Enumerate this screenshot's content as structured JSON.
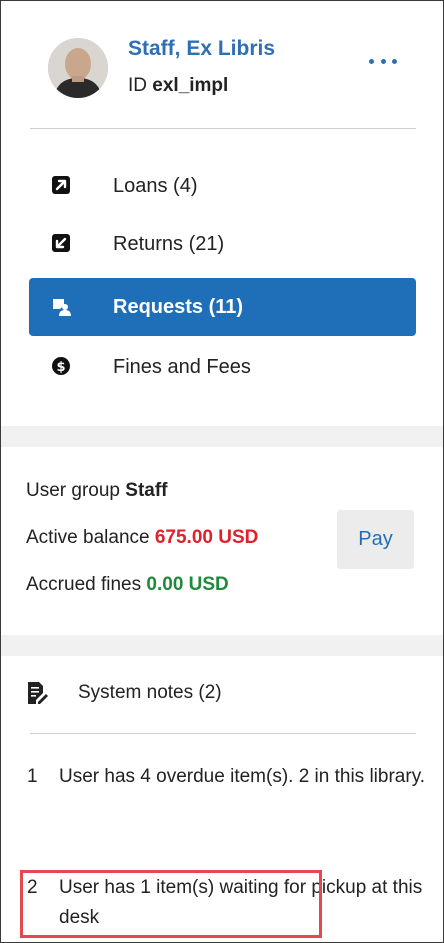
{
  "user": {
    "name": "Staff, Ex Libris",
    "id_label": "ID",
    "id_value": "exl_impl",
    "avatar_icon": "user-avatar-photo",
    "more_icon": "more-options-icon"
  },
  "nav": {
    "items": [
      {
        "label": "Loans (4)",
        "icon": "loan-out-icon"
      },
      {
        "label": "Returns (21)",
        "icon": "return-in-icon"
      },
      {
        "label": "Requests (11)",
        "icon": "requests-person-icon",
        "active": true
      },
      {
        "label": "Fines and Fees",
        "icon": "dollar-circle-icon"
      }
    ]
  },
  "account": {
    "user_group_label": "User group",
    "user_group_value": "Staff",
    "active_balance_label": "Active balance",
    "active_balance_value": "675.00 USD",
    "pay_label": "Pay",
    "accrued_fines_label": "Accrued fines",
    "accrued_fines_value": "0.00 USD"
  },
  "notes": {
    "title": "System notes (2)",
    "icon": "notes-edit-icon",
    "items": [
      {
        "num": "1",
        "text": "User has 4 overdue item(s). 2 in this library."
      },
      {
        "num": "2",
        "text": "User has 1 item(s) waiting for pickup at this desk"
      }
    ]
  },
  "colors": {
    "accent": "#1f6fb8",
    "link": "#2f6fb3",
    "balance_red": "#e0202a",
    "fines_green": "#1e8a3a",
    "highlight": "#e5484d"
  }
}
